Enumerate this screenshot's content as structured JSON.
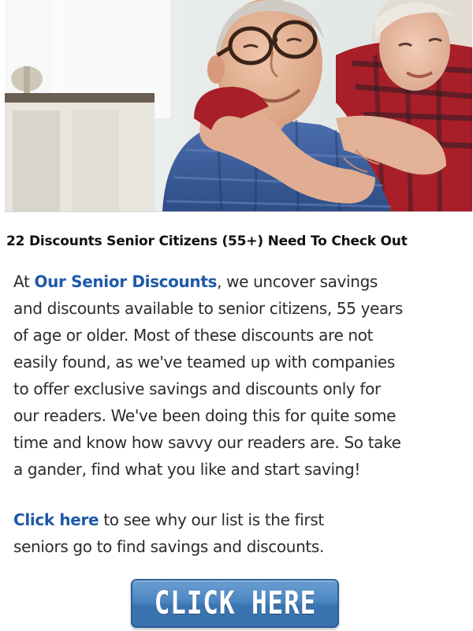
{
  "hero": {
    "icon": "senior-couple-photo",
    "colors": {
      "window": "#eef2f1",
      "shirt_blue": "#3c5f9a",
      "flannel_red": "#b3212b",
      "skin": "#e6b79a"
    }
  },
  "headline": "22 Discounts Senior Citizens (55+) Need To Check Out",
  "intro": {
    "prefix": "At ",
    "brand": "Our Senior Discounts",
    "line1_rest": ", we uncover savings",
    "lines": [
      "and discounts available to senior citizens, 55 years",
      "of age or older. Most of these discounts are not",
      "easily found, as we've teamed up with companies",
      "to offer exclusive savings and discounts only for",
      "our readers. We've been doing this for quite some",
      "time and know how savvy our readers are. So take",
      "a gander, find what you like and start saving!"
    ]
  },
  "cta": {
    "link_text": "Click here",
    "line1_rest": " to see why our list is the first",
    "line2": "seniors go to find savings and discounts.",
    "button_label": "CLICK HERE"
  },
  "colors": {
    "link": "#1f59a8",
    "text": "#2b2b2b",
    "button": "#4c86c2"
  }
}
